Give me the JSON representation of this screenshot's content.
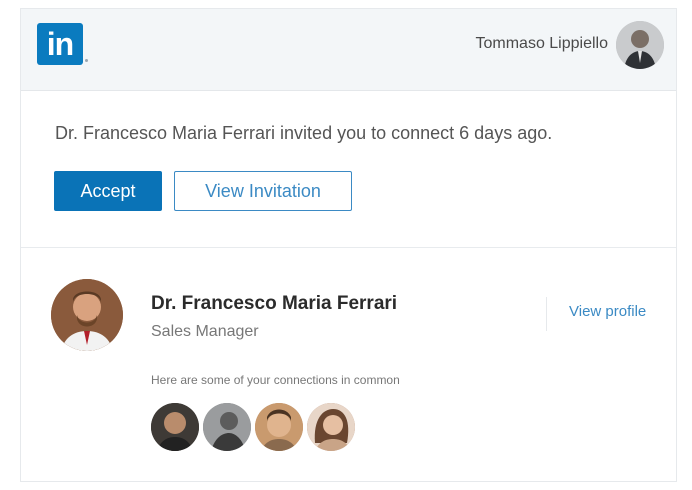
{
  "header": {
    "logo_text": "in",
    "username": "Tommaso Lippiello",
    "brand_color": "#0a7bbf"
  },
  "invitation": {
    "message": "Dr. Francesco Maria Ferrari invited you to connect 6 days ago.",
    "accept_label": "Accept",
    "view_invitation_label": "View Invitation"
  },
  "profile": {
    "name": "Dr. Francesco Maria Ferrari",
    "title": "Sales Manager",
    "view_profile_label": "View profile",
    "common_label": "Here are some of your connections in common"
  },
  "colors": {
    "accent": "#0a73b7",
    "link": "#3b8ac4",
    "header_bg": "#f3f6f8"
  }
}
